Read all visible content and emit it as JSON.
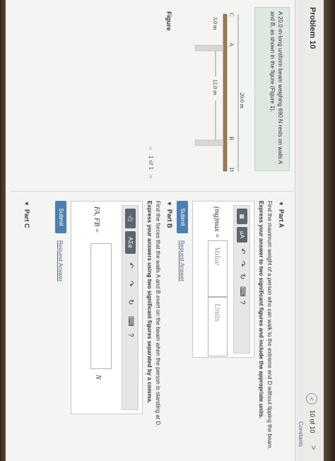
{
  "header": {
    "title": "Problem 10",
    "prev": "<",
    "count": "10 of 10",
    "next": ">",
    "constants": "Constants"
  },
  "problem": {
    "text": "A 20.0-m-long uniform beam weighing 690  N rests on walls A and B, as shown in the figure (Figure 1)."
  },
  "figure": {
    "label": "Figure",
    "labels": {
      "C": "C",
      "A": "A",
      "B": "B",
      "D": "D"
    },
    "dim_top": "20.0 m",
    "dim_left": "3.0 m",
    "dim_mid": "12.0 m",
    "pager": {
      "prev": "<",
      "count": "1 of 1",
      "next": ">"
    }
  },
  "partA": {
    "title": "Part A",
    "question": "Find the maximum weight of a person who can walk to the extreme end D without tipping the beam.",
    "instruction": "Express your answer to two significant figures and include the appropriate units.",
    "toolbar": {
      "mu": "μA",
      "help": "?"
    },
    "var_label": "(mg)max =",
    "value_placeholder": "Value",
    "units_placeholder": "Units",
    "submit": "Submit",
    "request": "Request Answer"
  },
  "partB": {
    "title": "Part B",
    "question": "Find the forces that the walls A and B exert on the beam when the person is standing at D.",
    "instruction": "Express your answers using two significant figures separated by a comma.",
    "toolbar": {
      "sqrt": "√▯",
      "sym": "ΑΣφ",
      "help": "?"
    },
    "var_label": "FA, FB =",
    "unit": "N",
    "submit": "Submit",
    "request": "Request Answer"
  },
  "partC": {
    "title": "Part C"
  }
}
